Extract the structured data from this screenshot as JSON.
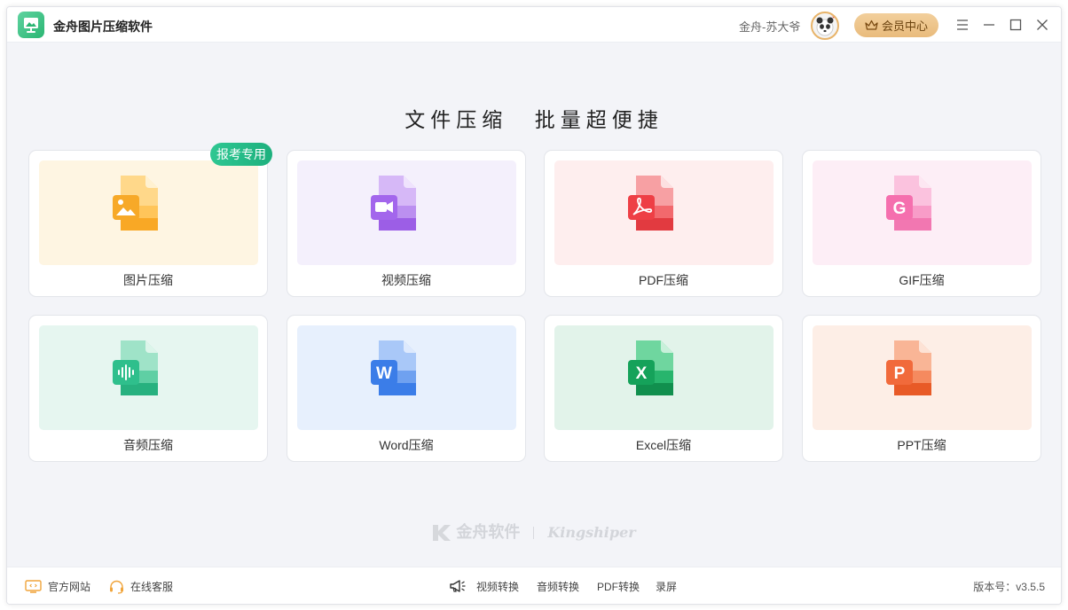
{
  "app": {
    "title": "金舟图片压缩软件"
  },
  "header": {
    "user_name": "金舟-苏大爷",
    "vip_label": "会员中心"
  },
  "headline": {
    "left": "文件压缩",
    "right": "批量超便捷"
  },
  "cards": [
    {
      "label": "图片压缩",
      "icon": "image-file-icon",
      "color": "#f7a928",
      "bg": "#fef5e2"
    },
    {
      "label": "视频压缩",
      "icon": "video-file-icon",
      "color": "#a366ec",
      "bg": "#f4f0fc"
    },
    {
      "label": "PDF压缩",
      "icon": "pdf-file-icon",
      "color": "#ee3f45",
      "bg": "#feeeee"
    },
    {
      "label": "GIF压缩",
      "icon": "gif-file-icon",
      "color": "#f56fae",
      "bg": "#fdeef6"
    },
    {
      "label": "音频压缩",
      "icon": "audio-file-icon",
      "color": "#2fbf8c",
      "bg": "#e6f6f0"
    },
    {
      "label": "Word压缩",
      "icon": "word-file-icon",
      "color": "#3b7de8",
      "bg": "#e7f0fd"
    },
    {
      "label": "Excel压缩",
      "icon": "excel-file-icon",
      "color": "#15a25a",
      "bg": "#e2f3ea"
    },
    {
      "label": "PPT压缩",
      "icon": "ppt-file-icon",
      "color": "#f16a3b",
      "bg": "#fdeee6"
    }
  ],
  "badge": "报考专用",
  "watermark": {
    "cn": "金舟软件",
    "en": "Kingshiper"
  },
  "footer": {
    "website": "官方网站",
    "service": "在线客服",
    "links": [
      "视频转换",
      "音频转换",
      "PDF转换",
      "录屏"
    ],
    "version": "版本号：v3.5.5"
  }
}
